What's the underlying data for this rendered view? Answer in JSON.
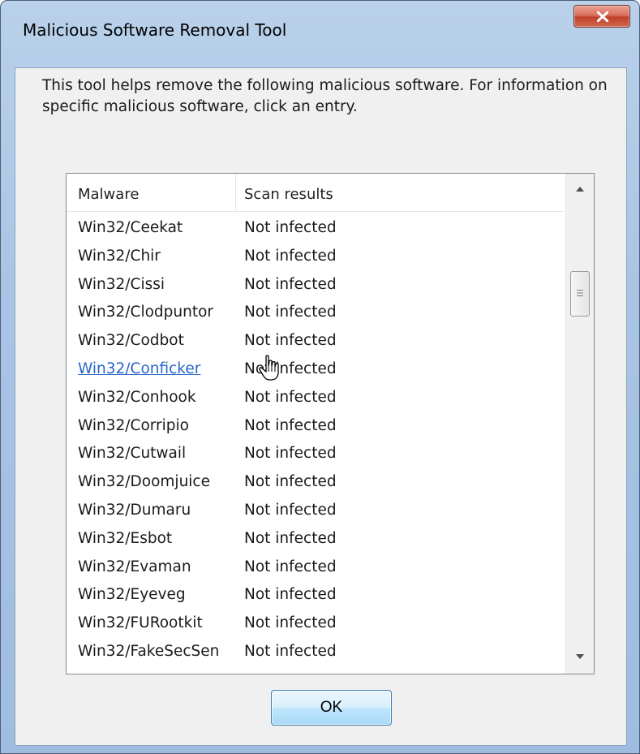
{
  "window": {
    "title": "Malicious Software Removal Tool",
    "close_icon": "close-icon"
  },
  "description": "This tool helps remove the following malicious software. For information on specific malicious software, click an entry.",
  "list": {
    "headers": {
      "malware": "Malware",
      "scan_results": "Scan results"
    },
    "rows": [
      {
        "name": "Win32/Ceekat",
        "result": "Not infected"
      },
      {
        "name": "Win32/Chir",
        "result": "Not infected"
      },
      {
        "name": "Win32/Cissi",
        "result": "Not infected"
      },
      {
        "name": "Win32/Clodpuntor",
        "result": "Not infected"
      },
      {
        "name": "Win32/Codbot",
        "result": "Not infected"
      },
      {
        "name": "Win32/Conficker",
        "result": "Not infected",
        "hovered": true
      },
      {
        "name": "Win32/Conhook",
        "result": "Not infected"
      },
      {
        "name": "Win32/Corripio",
        "result": "Not infected"
      },
      {
        "name": "Win32/Cutwail",
        "result": "Not infected"
      },
      {
        "name": "Win32/Doomjuice",
        "result": "Not infected"
      },
      {
        "name": "Win32/Dumaru",
        "result": "Not infected"
      },
      {
        "name": "Win32/Esbot",
        "result": "Not infected"
      },
      {
        "name": "Win32/Evaman",
        "result": "Not infected"
      },
      {
        "name": "Win32/Eyeveg",
        "result": "Not infected"
      },
      {
        "name": "Win32/FURootkit",
        "result": "Not infected"
      },
      {
        "name": "Win32/FakeSecSen",
        "result": "Not infected"
      }
    ]
  },
  "buttons": {
    "ok_label": "OK"
  },
  "colors": {
    "link": "#2667c9",
    "titlebar": "#b9d1ea",
    "close_button": "#c0402a"
  }
}
